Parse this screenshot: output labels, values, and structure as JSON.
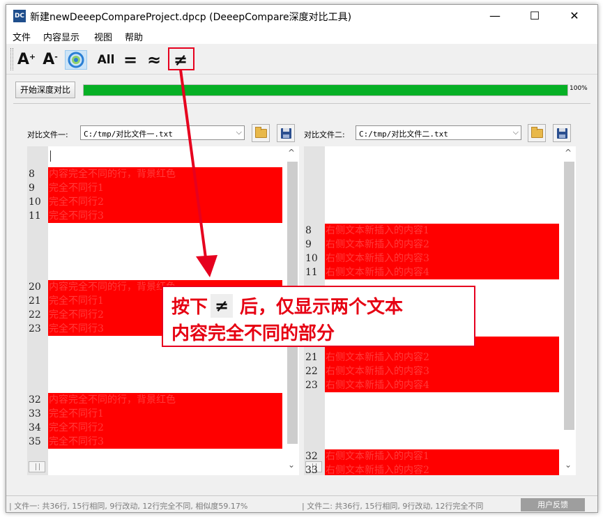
{
  "window": {
    "app_icon": "DC",
    "title": "新建newDeeepCompareProject.dpcp  (DeeepCompare深度对比工具)",
    "minimize_glyph": "—",
    "maximize_glyph": "☐",
    "close_glyph": "✕"
  },
  "menu": [
    "文件",
    "内容显示",
    "视图",
    "帮助"
  ],
  "toolbar": {
    "font_increase": "A",
    "font_increase_sup": "+",
    "font_decrease": "A",
    "font_decrease_sup": "-",
    "all_label": "All",
    "equal_label": "=",
    "similar_label": "≈",
    "not_equal_label": "≠"
  },
  "progress": {
    "start_button": "开始深度对比",
    "value": 1.0,
    "label": "100%"
  },
  "left": {
    "label": "对比文件一:",
    "path": "C:/tmp/对比文件一.txt",
    "rows": [
      {
        "ln": "8",
        "text": "内容完全不同的行，背景红色"
      },
      {
        "ln": "9",
        "text": "完全不同行1"
      },
      {
        "ln": "10",
        "text": "完全不同行2"
      },
      {
        "ln": "11",
        "text": "完全不同行3"
      },
      {
        "ln": "20",
        "text": "内容完全不同的行，背景红色"
      },
      {
        "ln": "21",
        "text": "完全不同行1"
      },
      {
        "ln": "22",
        "text": "完全不同行2"
      },
      {
        "ln": "23",
        "text": "完全不同行3"
      },
      {
        "ln": "32",
        "text": "内容完全不同的行，背景红色"
      },
      {
        "ln": "33",
        "text": "完全不同行1"
      },
      {
        "ln": "34",
        "text": "完全不同行2"
      },
      {
        "ln": "35",
        "text": "完全不同行3"
      }
    ]
  },
  "right": {
    "label": "对比文件二:",
    "path": "C:/tmp/对比文件二.txt",
    "rows": [
      {
        "ln": "8",
        "text": "右侧文本新插入的内容1"
      },
      {
        "ln": "9",
        "text": "右侧文本新插入的内容2"
      },
      {
        "ln": "10",
        "text": "右侧文本新插入的内容3"
      },
      {
        "ln": "11",
        "text": "右侧文本新插入的内容4"
      },
      {
        "ln": "21",
        "text": "右侧文本新插入的内容2"
      },
      {
        "ln": "22",
        "text": "右侧文本新插入的内容3"
      },
      {
        "ln": "23",
        "text": "右侧文本新插入的内容4"
      },
      {
        "ln": "32",
        "text": "右侧文本新插入的内容1"
      },
      {
        "ln": "33",
        "text": "右侧文本新插入的内容2"
      }
    ]
  },
  "scroll": {
    "up": "^",
    "down": "⌄"
  },
  "callout": {
    "line1_before": "按下",
    "key": "≠",
    "line1_after": "后，仅显示两个文本",
    "line2": "内容完全不同的部分"
  },
  "status": {
    "left": "| 文件一: 共36行, 15行相同, 9行改动, 12行完全不同, 相似度59.17%",
    "right": "| 文件二: 共36行, 15行相同, 9行改动, 12行完全不同",
    "feedback": "用户反馈"
  },
  "colors": {
    "diff_bg": "#ff0000",
    "progress": "#06b025",
    "annotation": "#e6001e"
  }
}
